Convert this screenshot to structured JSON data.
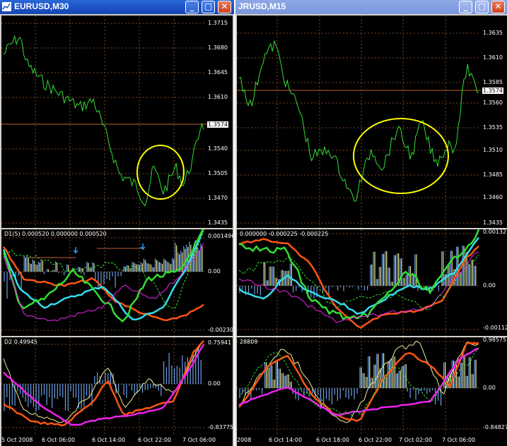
{
  "left": {
    "title": "EURUSD,M30",
    "price_levels": [
      "1.3715",
      "1.3680",
      "1.3645",
      "1.3610",
      "1.3574",
      "1.3540",
      "1.3505",
      "1.3470",
      "1.3435"
    ],
    "current_price": "1.3574",
    "ind1": {
      "label": "D1(5) 0.000520 0.000000 0.000520",
      "levels": [
        "0.001496",
        "0.00",
        "-0.00230"
      ]
    },
    "ind2": {
      "label": "D2 0.49945",
      "levels": [
        "0.75941",
        "0.00",
        "-0.83775"
      ]
    },
    "time_labels": [
      "5 Oct 2008",
      "6 Oct 06:00",
      "6 Oct 14:00",
      "6 Oct 22:00",
      "7 Oct 06:00"
    ]
  },
  "right": {
    "title": "JRUSD,M15",
    "price_levels": [
      "1.3635",
      "1.3610",
      "1.3585",
      "1.3574",
      "1.3560",
      "1.3535",
      "1.3510",
      "1.3485",
      "1.3460",
      "1.3435"
    ],
    "current_price": "1.3574",
    "ind1": {
      "label": "0.000000 -0.000225 -0.000225",
      "levels": [
        "0.00132",
        "0.00",
        "-0.00112"
      ]
    },
    "ind2": {
      "label": "28809",
      "levels": [
        "0.98575",
        "0.00",
        "-0.84827"
      ]
    },
    "time_labels": [
      "2008",
      "6 Oct 14:00",
      "6 Oct 18:00",
      "6 Oct 22:00",
      "7 Oct 02:00",
      "7 Oct 06:00"
    ]
  },
  "colors": {
    "price": "#33dd33",
    "grid": "#7a4a2a",
    "hline": "#c06030",
    "ellipse": "#ffff00",
    "cyan": "#33ddee",
    "orange": "#ff5511",
    "magenta": "#ee22ee",
    "yellowish": "#eeee99",
    "steel": "#6aa0e8"
  },
  "icons": {
    "window": "chart-window-icon",
    "minimize": "minimize-icon",
    "maximize": "maximize-icon",
    "close": "close-icon",
    "arrow": "arrow-down-icon"
  }
}
